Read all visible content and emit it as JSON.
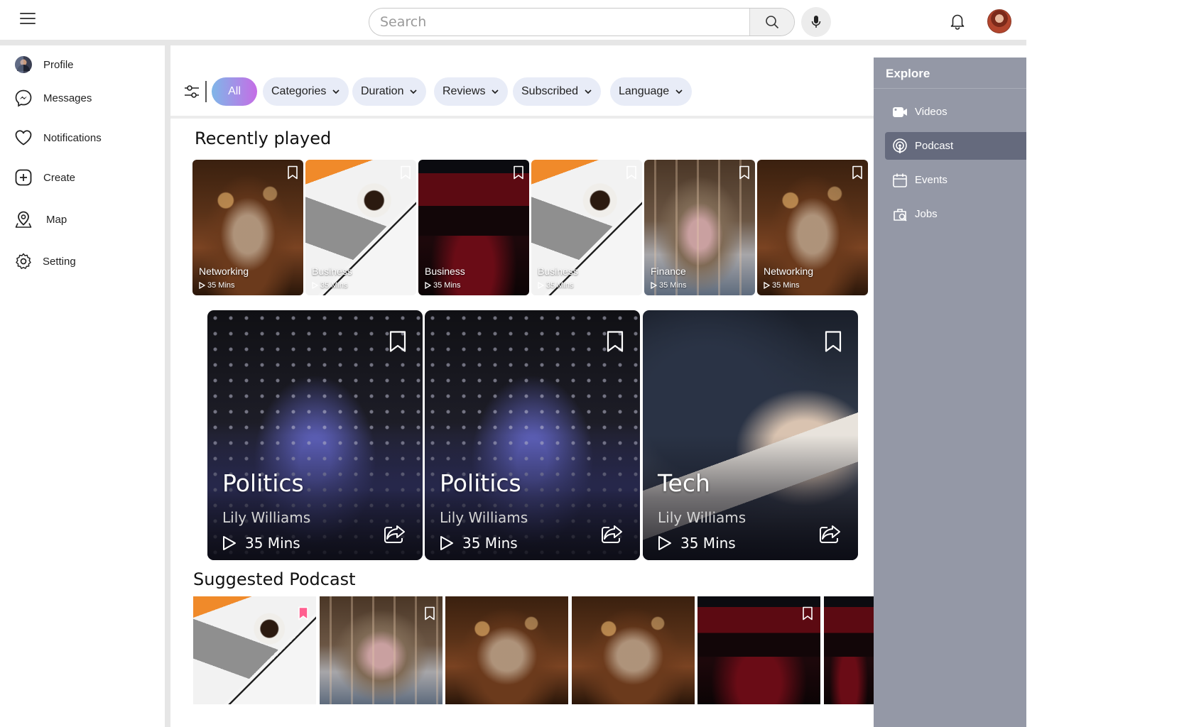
{
  "header": {
    "search_placeholder": "Search"
  },
  "sidebar": {
    "items": [
      {
        "label": "Profile"
      },
      {
        "label": "Messages"
      },
      {
        "label": "Notifications"
      },
      {
        "label": "Create"
      },
      {
        "label": "Map"
      },
      {
        "label": "Setting"
      }
    ]
  },
  "filters": {
    "all": "All",
    "chips": [
      "Categories",
      "Duration",
      "Reviews",
      "Subscribed",
      "Language"
    ]
  },
  "recently_played": {
    "title": "Recently played",
    "items": [
      {
        "category": "Networking",
        "duration": "35 Mins"
      },
      {
        "category": "Business",
        "duration": "35 Mins"
      },
      {
        "category": "Business",
        "duration": "35 Mins"
      },
      {
        "category": "Business",
        "duration": "35 Mins"
      },
      {
        "category": "Finance",
        "duration": "35 Mins"
      },
      {
        "category": "Networking",
        "duration": "35 Mins"
      }
    ]
  },
  "featured": [
    {
      "title": "Politics",
      "author": "Lily Williams",
      "duration": "35 Mins"
    },
    {
      "title": "Politics",
      "author": "Lily Williams",
      "duration": "35 Mins"
    },
    {
      "title": "Tech",
      "author": "Lily Williams",
      "duration": "35 Mins"
    }
  ],
  "suggested": {
    "title": "Suggested Podcast"
  },
  "explore": {
    "title": "Explore",
    "items": [
      {
        "label": "Videos"
      },
      {
        "label": "Podcast"
      },
      {
        "label": "Events"
      },
      {
        "label": "Jobs"
      }
    ]
  },
  "colors": {
    "explore_panel": "#9498a6",
    "explore_active": "#656a7d",
    "chip_bg": "#e8ecf7",
    "bookmark_accent": "#ff5f8f"
  }
}
